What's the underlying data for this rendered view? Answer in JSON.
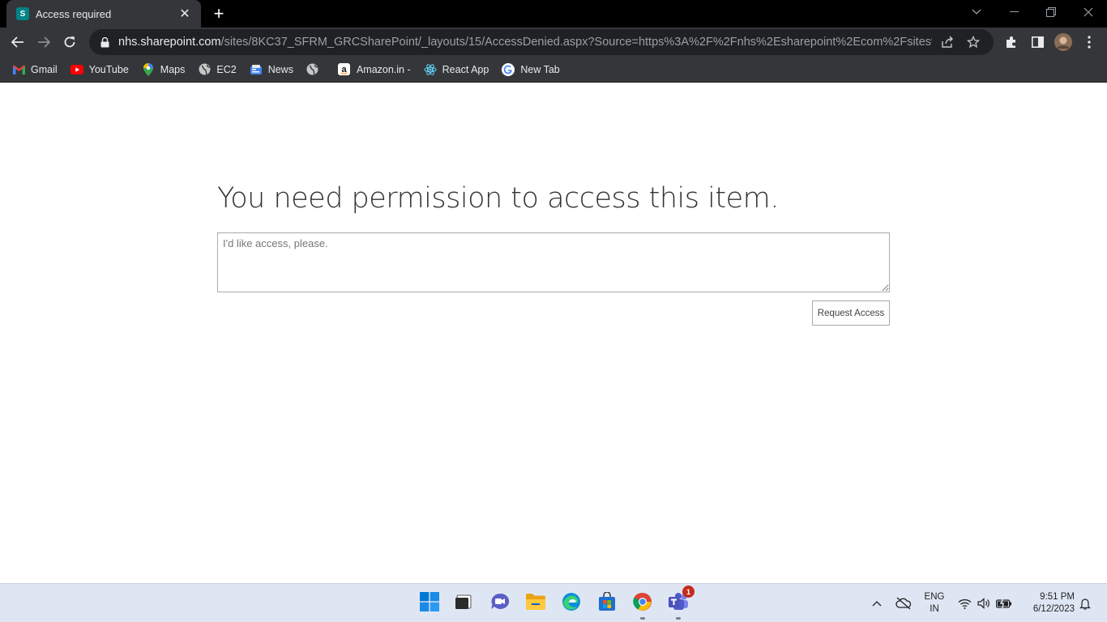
{
  "browser": {
    "tab": {
      "title": "Access required",
      "favicon_letter": "S"
    },
    "new_tab_symbol": "+",
    "address": {
      "host": "nhs.sharepoint.com",
      "path": "/sites/8KC37_SFRM_GRCSharePoint/_layouts/15/AccessDenied.aspx?Source=https%3A%2F%2Fnhs%2Esharepoint%2Ecom%2Fsites%2F8KC37_S..."
    },
    "bookmarks": [
      {
        "label": "Gmail",
        "icon": "gmail-icon"
      },
      {
        "label": "YouTube",
        "icon": "youtube-icon"
      },
      {
        "label": "Maps",
        "icon": "maps-icon"
      },
      {
        "label": "EC2",
        "icon": "globe-icon"
      },
      {
        "label": "News",
        "icon": "news-icon"
      },
      {
        "label": "",
        "icon": "globe-icon"
      },
      {
        "label": "Amazon.in -",
        "icon": "amazon-icon"
      },
      {
        "label": "React App",
        "icon": "react-icon"
      },
      {
        "label": "New Tab",
        "icon": "google-icon"
      }
    ]
  },
  "page": {
    "heading": "You need permission to access this item.",
    "message_placeholder": "I'd like access, please.",
    "message_value": "",
    "request_button_label": "Request Access"
  },
  "taskbar": {
    "apps": [
      "start",
      "task-view",
      "chat",
      "file-explorer",
      "edge",
      "microsoft-store",
      "chrome",
      "teams"
    ],
    "teams_badge": "1",
    "language_line1": "ENG",
    "language_line2": "IN",
    "time": "9:51 PM",
    "date": "6/12/2023"
  }
}
